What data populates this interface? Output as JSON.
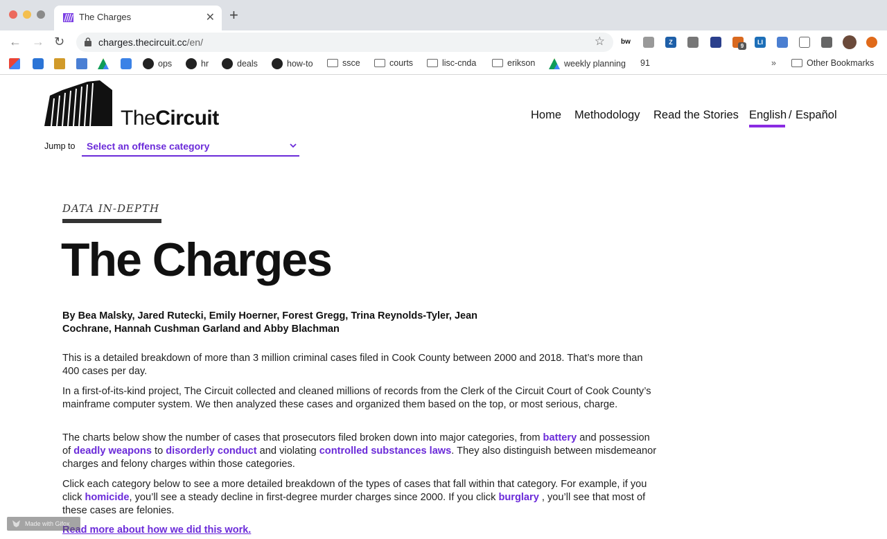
{
  "browser": {
    "tab_title": "The Charges",
    "new_tab_symbol": "+",
    "close_symbol": "✕",
    "url_host": "charges.thecircuit.cc",
    "url_path": "/en/",
    "bookmarks": [
      {
        "label": "ops",
        "icon": "github-icon"
      },
      {
        "label": "hr",
        "icon": "github-icon"
      },
      {
        "label": "deals",
        "icon": "github-icon"
      },
      {
        "label": "how-to",
        "icon": "github-icon"
      },
      {
        "label": "ssce",
        "icon": "folder-icon"
      },
      {
        "label": "courts",
        "icon": "folder-icon"
      },
      {
        "label": "lisc-cnda",
        "icon": "folder-icon"
      },
      {
        "label": "erikson",
        "icon": "folder-icon"
      },
      {
        "label": "weekly planning",
        "icon": "drive-icon"
      },
      {
        "label": "91",
        "icon": ""
      }
    ],
    "bookmarks_overflow": "»",
    "other_bookmarks": "Other Bookmarks",
    "extension_badge": "9"
  },
  "site": {
    "logo_text_light": "The",
    "logo_text_bold": "Circuit",
    "nav": {
      "home": "Home",
      "methodology": "Methodology",
      "stories": "Read the Stories",
      "english": "English",
      "separator": "/",
      "spanish": "Español"
    },
    "jump": {
      "label": "Jump to",
      "value": "Select an offense category"
    }
  },
  "article": {
    "kicker": "DATA IN-DEPTH",
    "title": "The Charges",
    "byline_1": "By Bea Malsky, Jared Rutecki, Emily Hoerner, Forest Gregg, Trina Reynolds-Tyler, Jean",
    "byline_2": "Cochrane, Hannah Cushman Garland and Abby Blachman",
    "p1": "This is a detailed breakdown of more than 3 million criminal cases filed in Cook County between 2000 and 2018. That’s more than 400 cases per day.",
    "p2": "In a first-of-its-kind project, The Circuit collected and cleaned millions of records from the Clerk of the Circuit Court of Cook County’s mainframe computer system. We then analyzed these cases and organized them based on the top, or most serious, charge.",
    "p3_a": "The charts below show the number of cases that prosecutors filed broken down into major categories, from ",
    "p3_link1": "battery",
    "p3_b": " and possession of ",
    "p3_link2": "deadly weapons",
    "p3_c": " to ",
    "p3_link3": "disorderly conduct",
    "p3_d": " and violating ",
    "p3_link4": "controlled substances laws",
    "p3_e": ". They also distinguish between misdemeanor charges and felony charges within those categories.",
    "p4_a": "Click each category below to see a more detailed breakdown of the types of cases that fall within that category. For example, if you click ",
    "p4_link1": "homicide",
    "p4_b": ", you’ll see a steady decline in first-degree murder charges since 2000. If you click ",
    "p4_link2": "burglary",
    "p4_c": " , you’ll see that most of these cases are felonies.",
    "more_link": "Read more about how we did this work.",
    "gif_badge": "Made with Gifox"
  },
  "colors": {
    "accent": "#6b2bd9",
    "underline": "#8a2be2"
  }
}
